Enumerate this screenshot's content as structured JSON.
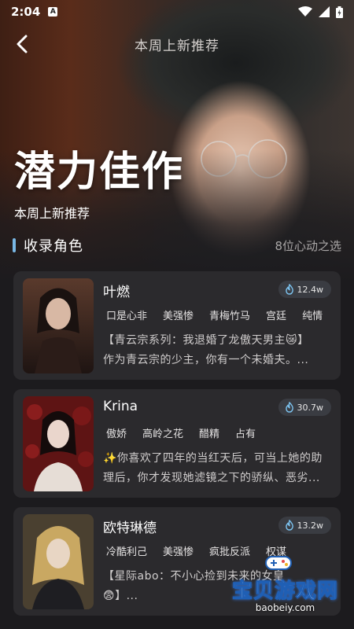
{
  "status_bar": {
    "time": "2:04",
    "badge": "A"
  },
  "header": {
    "title": "本周上新推荐",
    "back_icon": "chevron-left-icon"
  },
  "hero": {
    "title": "潜力佳作",
    "subtitle": "本周上新推荐"
  },
  "section": {
    "title": "收录角色",
    "count_text": "8位心动之选",
    "accent": "#79b8e6"
  },
  "cards": [
    {
      "name": "叶燃",
      "heat": "12.4w",
      "tags": [
        "口是心非",
        "美强惨",
        "青梅竹马",
        "宫廷",
        "纯情"
      ],
      "desc_line1": "【青云宗系列：我退婚了龙傲天男主😿】",
      "desc_line2": "作为青云宗的少主，你有一个未婚夫。..."
    },
    {
      "name": "Krina",
      "heat": "30.7w",
      "tags": [
        "傲娇",
        "高岭之花",
        "醋精",
        "占有"
      ],
      "desc_line1": "✨你喜欢了四年的当红天后，可当上她的助",
      "desc_line2": "理后，你才发现她滤镜之下的骄纵、恶劣..."
    },
    {
      "name": "欧特琳德",
      "heat": "13.2w",
      "tags": [
        "冷酷利己",
        "美强惨",
        "疯批反派",
        "权谋"
      ],
      "desc_line1": "【星际abo：不小心捡到未来的女皇",
      "desc_line2": "😨】..."
    }
  ],
  "watermark": {
    "text": "宝贝游戏网",
    "url": "baobeiy.com"
  }
}
